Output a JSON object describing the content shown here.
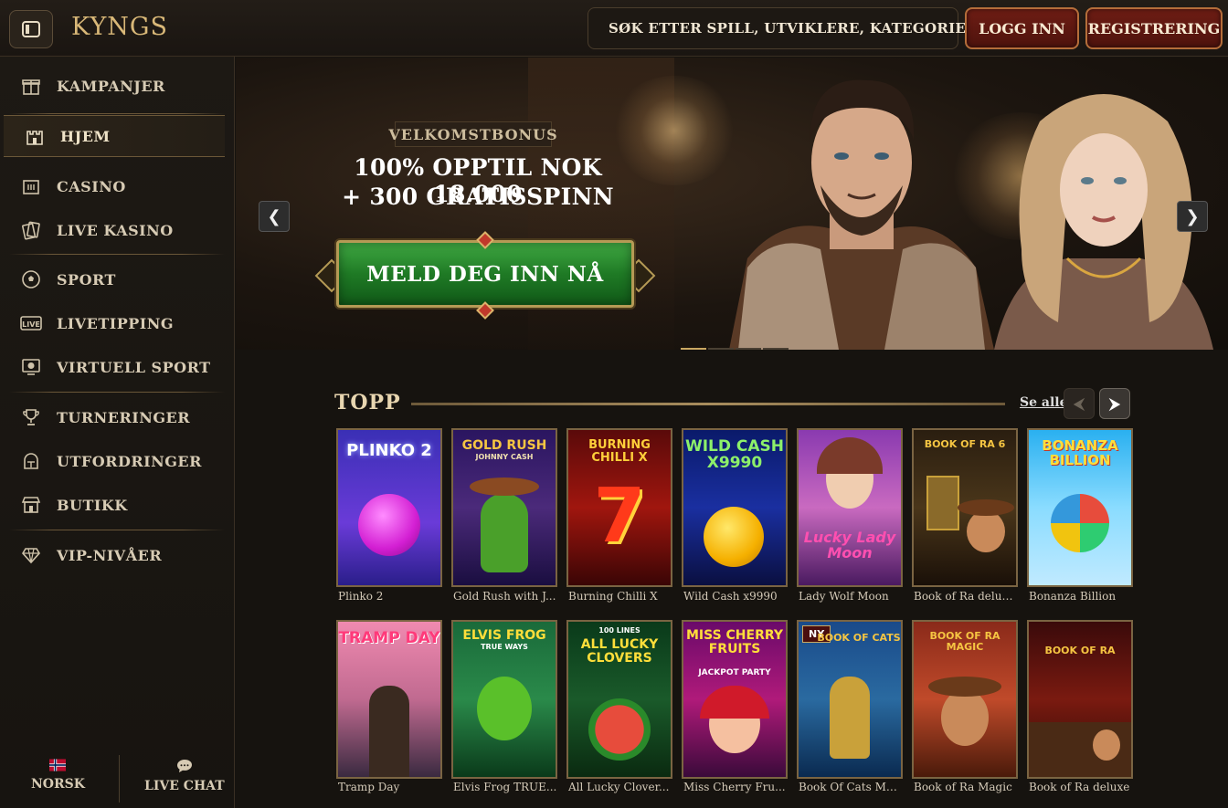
{
  "header": {
    "logo": "KYNGS",
    "search_placeholder": "SØK ETTER SPILL, UTVIKLERE, KATEGORIER",
    "login_label": "LOGG INN",
    "register_label": "REGISTRERING"
  },
  "sidebar": {
    "items": [
      {
        "label": "KAMPANJER",
        "icon": "gift-icon"
      },
      {
        "label": "HJEM",
        "icon": "castle-icon",
        "active": true
      },
      {
        "label": "CASINO",
        "icon": "slot-machine-icon"
      },
      {
        "label": "LIVE KASINO",
        "icon": "cards-icon"
      },
      {
        "label": "SPORT",
        "icon": "soccer-ball-icon"
      },
      {
        "label": "LIVETIPPING",
        "icon": "live-icon"
      },
      {
        "label": "VIRTUELL SPORT",
        "icon": "monitor-ball-icon"
      },
      {
        "label": "TURNERINGER",
        "icon": "trophy-icon"
      },
      {
        "label": "UTFORDRINGER",
        "icon": "helmet-icon"
      },
      {
        "label": "BUTIKK",
        "icon": "shop-icon"
      },
      {
        "label": "VIP-NIVÅER",
        "icon": "diamond-icon"
      }
    ],
    "footer": {
      "language_label": "NORSK",
      "chat_label": "LIVE CHAT"
    }
  },
  "hero": {
    "tag": "VELKOMSTBONUS",
    "line1": "100% OPPTIL NOK 18.000",
    "line2": "+ 300 GRATISSPINN",
    "cta_label": "MELD DEG INN NÅ",
    "slides_total": 4,
    "active_slide": 1
  },
  "top_section": {
    "title": "TOPP",
    "see_all": "Se alle",
    "row1": [
      {
        "title": "Plinko 2",
        "art": "PLINKO 2"
      },
      {
        "title": "Gold Rush with J...",
        "art": "GOLD RUSH",
        "art_sub": "JOHNNY CASH"
      },
      {
        "title": "Burning Chilli X",
        "art": "BURNING CHILLI X"
      },
      {
        "title": "Wild Cash x9990",
        "art": "WILD CASH X9990"
      },
      {
        "title": "Lady Wolf Moon",
        "art": "Lucky Lady Moon"
      },
      {
        "title": "Book of Ra delux...",
        "art": "BOOK OF RA 6"
      },
      {
        "title": "Bonanza Billion",
        "art": "BONANZA BILLION"
      }
    ],
    "row2": [
      {
        "title": "Tramp Day",
        "art": "TRAMP DAY"
      },
      {
        "title": "Elvis Frog TRUE...",
        "art": "ELVIS FROG",
        "art_sub": "TRUE WAYS"
      },
      {
        "title": "All Lucky Clover...",
        "art": "ALL LUCKY CLOVERS",
        "art_sub": "100 LINES"
      },
      {
        "title": "Miss Cherry Fru...",
        "art": "MISS CHERRY FRUITS",
        "art_sub": "JACKPOT PARTY"
      },
      {
        "title": "Book Of Cats Me...",
        "art": "BOOK OF CATS",
        "badge": "NY"
      },
      {
        "title": "Book of Ra Magic",
        "art": "BOOK OF RA MAGIC"
      },
      {
        "title": "Book of Ra deluxe",
        "art": "BOOK OF RA"
      }
    ]
  }
}
